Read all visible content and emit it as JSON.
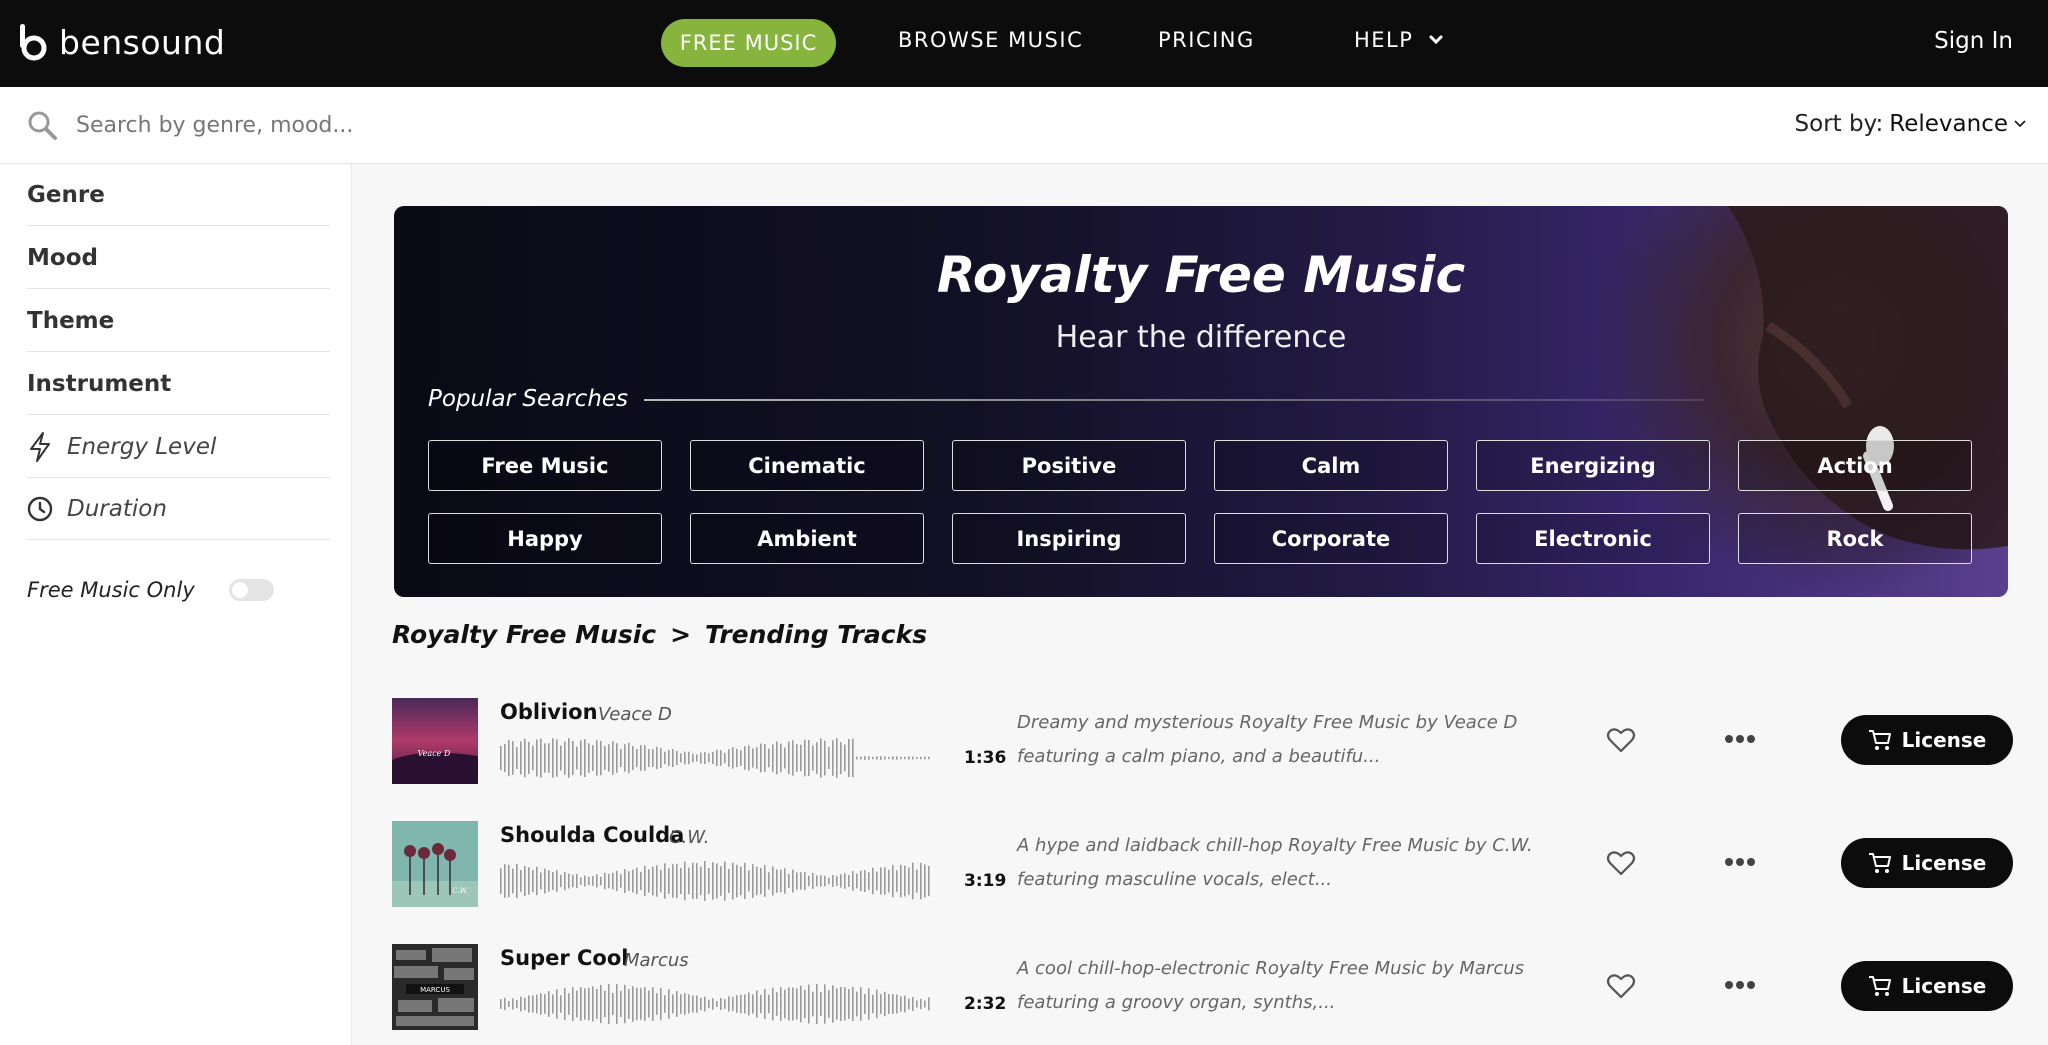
{
  "nav": {
    "logo_text": "bensound",
    "free_music": "FREE MUSIC",
    "browse_music": "BROWSE MUSIC",
    "pricing": "PRICING",
    "help": "HELP",
    "sign_in": "Sign In",
    "accent_color": "#86b43c"
  },
  "search": {
    "placeholder": "Search by genre, mood...",
    "sort_label": "Sort by:",
    "sort_value": "Relevance"
  },
  "sidebar": {
    "items": [
      {
        "label": "Genre"
      },
      {
        "label": "Mood"
      },
      {
        "label": "Theme"
      },
      {
        "label": "Instrument"
      },
      {
        "label": "Energy Level",
        "icon": "lightning-icon"
      },
      {
        "label": "Duration",
        "icon": "clock-icon"
      }
    ],
    "free_only_label": "Free Music Only",
    "free_only_enabled": false
  },
  "hero": {
    "title": "Royalty Free Music",
    "subtitle": "Hear the difference",
    "popular_label": "Popular Searches",
    "tags": [
      "Free Music",
      "Cinematic",
      "Positive",
      "Calm",
      "Energizing",
      "Action",
      "Happy",
      "Ambient",
      "Inspiring",
      "Corporate",
      "Electronic",
      "Rock"
    ]
  },
  "breadcrumb": {
    "root": "Royalty Free Music",
    "separator": ">",
    "current": "Trending Tracks"
  },
  "tracks": [
    {
      "title": "Oblivion",
      "artist": "Veace D",
      "duration": "1:36",
      "description": "Dreamy and mysterious Royalty Free Music by Veace D featuring a calm piano, and a beautifu...",
      "license_label": "License",
      "cover_caption": "Veace D"
    },
    {
      "title": "Shoulda Coulda",
      "artist": "C.W.",
      "duration": "3:19",
      "description": "A hype and laidback chill-hop Royalty Free Music by C.W. featuring masculine vocals, elect...",
      "license_label": "License",
      "cover_caption": "C.W."
    },
    {
      "title": "Super Cool",
      "artist": "Marcus",
      "duration": "2:32",
      "description": "A cool chill-hop-electronic Royalty Free Music by Marcus featuring a groovy organ, synths,...",
      "license_label": "License",
      "cover_caption": "MARCUS"
    }
  ]
}
